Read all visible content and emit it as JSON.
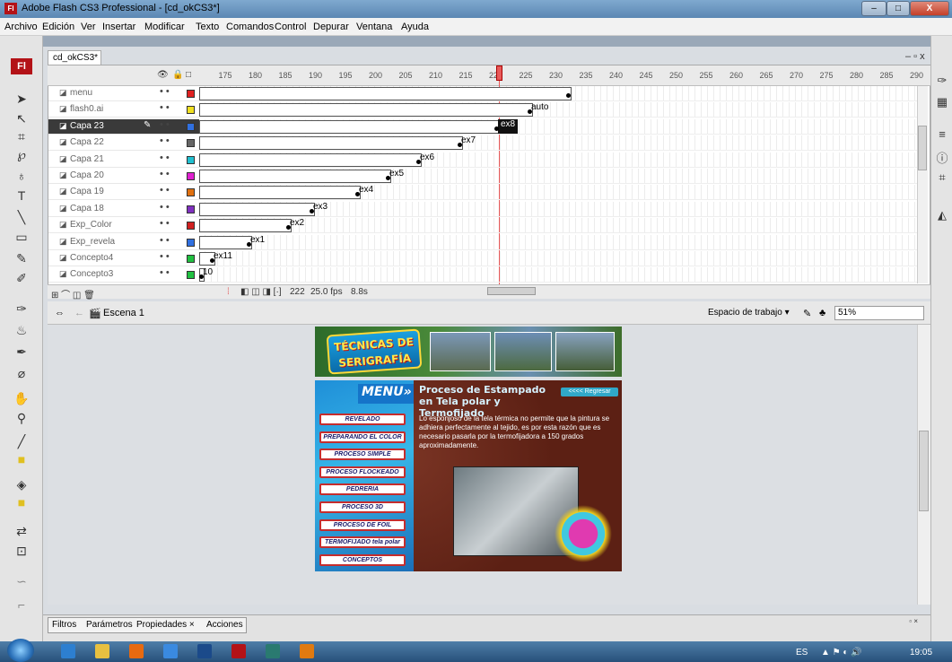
{
  "window": {
    "app_icon": "Fl",
    "title": "Adobe Flash CS3 Professional - [cd_okCS3*]",
    "controls": {
      "minimize": "–",
      "maximize": "□",
      "close": "X"
    }
  },
  "menubar": [
    "Archivo",
    "Edición",
    "Ver",
    "Insertar",
    "Modificar",
    "Texto",
    "Comandos",
    "Control",
    "Depurar",
    "Ventana",
    "Ayuda"
  ],
  "document": {
    "tab": "cd_okCS3*",
    "controls": "– ▫ x"
  },
  "toolbar": {
    "logo": "Fl",
    "tools": [
      "selection-tool-icon",
      "subselection-tool-icon",
      "free-transform-icon",
      "lasso-icon",
      "pen-icon",
      "text-icon",
      "line-icon",
      "rectangle-icon",
      "pencil-icon",
      "brush-icon",
      "ink-bottle-icon",
      "paint-bucket-icon",
      "eyedropper-icon",
      "eraser-icon",
      "hand-icon",
      "zoom-icon",
      "stroke-color-icon",
      "fill-color-icon",
      "swap-colors-icon",
      "snap-icon",
      "smooth-icon",
      "straighten-icon"
    ]
  },
  "timeline": {
    "header_icons": {
      "eye": "👁",
      "lock": "🔒",
      "outline": "□"
    },
    "frame_ticks": [
      "175",
      "180",
      "185",
      "190",
      "195",
      "200",
      "205",
      "210",
      "215",
      "220",
      "225",
      "230",
      "235",
      "240",
      "245",
      "250",
      "255",
      "260",
      "265",
      "270",
      "275",
      "280",
      "285",
      "290"
    ],
    "layers": [
      {
        "name": "menu",
        "color": "#e02020",
        "selected": false
      },
      {
        "name": "flash0.ai",
        "color": "#f0e020",
        "selected": false
      },
      {
        "name": "Capa 23",
        "color": "#3070e0",
        "selected": true
      },
      {
        "name": "Capa 22",
        "color": "#666666",
        "selected": false
      },
      {
        "name": "Capa 21",
        "color": "#20c0d0",
        "selected": false
      },
      {
        "name": "Capa 20",
        "color": "#e020d0",
        "selected": false
      },
      {
        "name": "Capa 19",
        "color": "#e07010",
        "selected": false
      },
      {
        "name": "Capa 18",
        "color": "#8030c0",
        "selected": false
      },
      {
        "name": "Exp_Color",
        "color": "#d02020",
        "selected": false
      },
      {
        "name": "Exp_revela",
        "color": "#3070e0",
        "selected": false
      },
      {
        "name": "Concepto4",
        "color": "#20c040",
        "selected": false
      },
      {
        "name": "Concepto3",
        "color": "#20c040",
        "selected": false
      }
    ],
    "keyframe_labels": [
      "",
      "auto",
      "ex8",
      "ex7",
      "ex6",
      "ex5",
      "ex4",
      "ex3",
      "ex2",
      "ex1",
      "ex11",
      "10"
    ],
    "footer": {
      "current_frame": "222",
      "fps": "25.0 fps",
      "elapsed": "8.8s"
    }
  },
  "scene": {
    "name": "Escena 1",
    "workspace_label": "Espacio de trabajo ▾",
    "zoom": "51%"
  },
  "stage": {
    "banner_title": "TÉCNICAS DE SERIGRAFÍA",
    "menu_title": "MENU»",
    "menu_items": [
      "REVELADO",
      "PREPARANDO EL COLOR",
      "PROCESO SIMPLE",
      "PROCESO FLOCKEADO",
      "PEDRERIA",
      "PROCESO 3D",
      "PROCESO DE FOIL",
      "TERMOFIJADO tela polar",
      "CONCEPTOS"
    ],
    "content_title": "Proceso de Estampado en Tela polar y Termofijado",
    "back_button": "<<<< Regresar",
    "content_body": "Lo esponjoso de la tela térmica no permite que la pintura se adhiera perfectamente al tejido, es por esta razón que es necesario pasarla por la termofijadora a 150 grados aproximadamente."
  },
  "bottom_panel": {
    "tabs": [
      "Filtros",
      "Parámetros",
      "Propiedades ×",
      "Acciones"
    ]
  },
  "taskbar": {
    "apps": [
      "ie-icon",
      "explorer-icon",
      "firefox-icon",
      "media-icon",
      "photoshop-icon",
      "flash-icon",
      "dreamweaver-icon",
      "illustrator-icon"
    ],
    "lang": "ES",
    "clock": "19:05"
  }
}
